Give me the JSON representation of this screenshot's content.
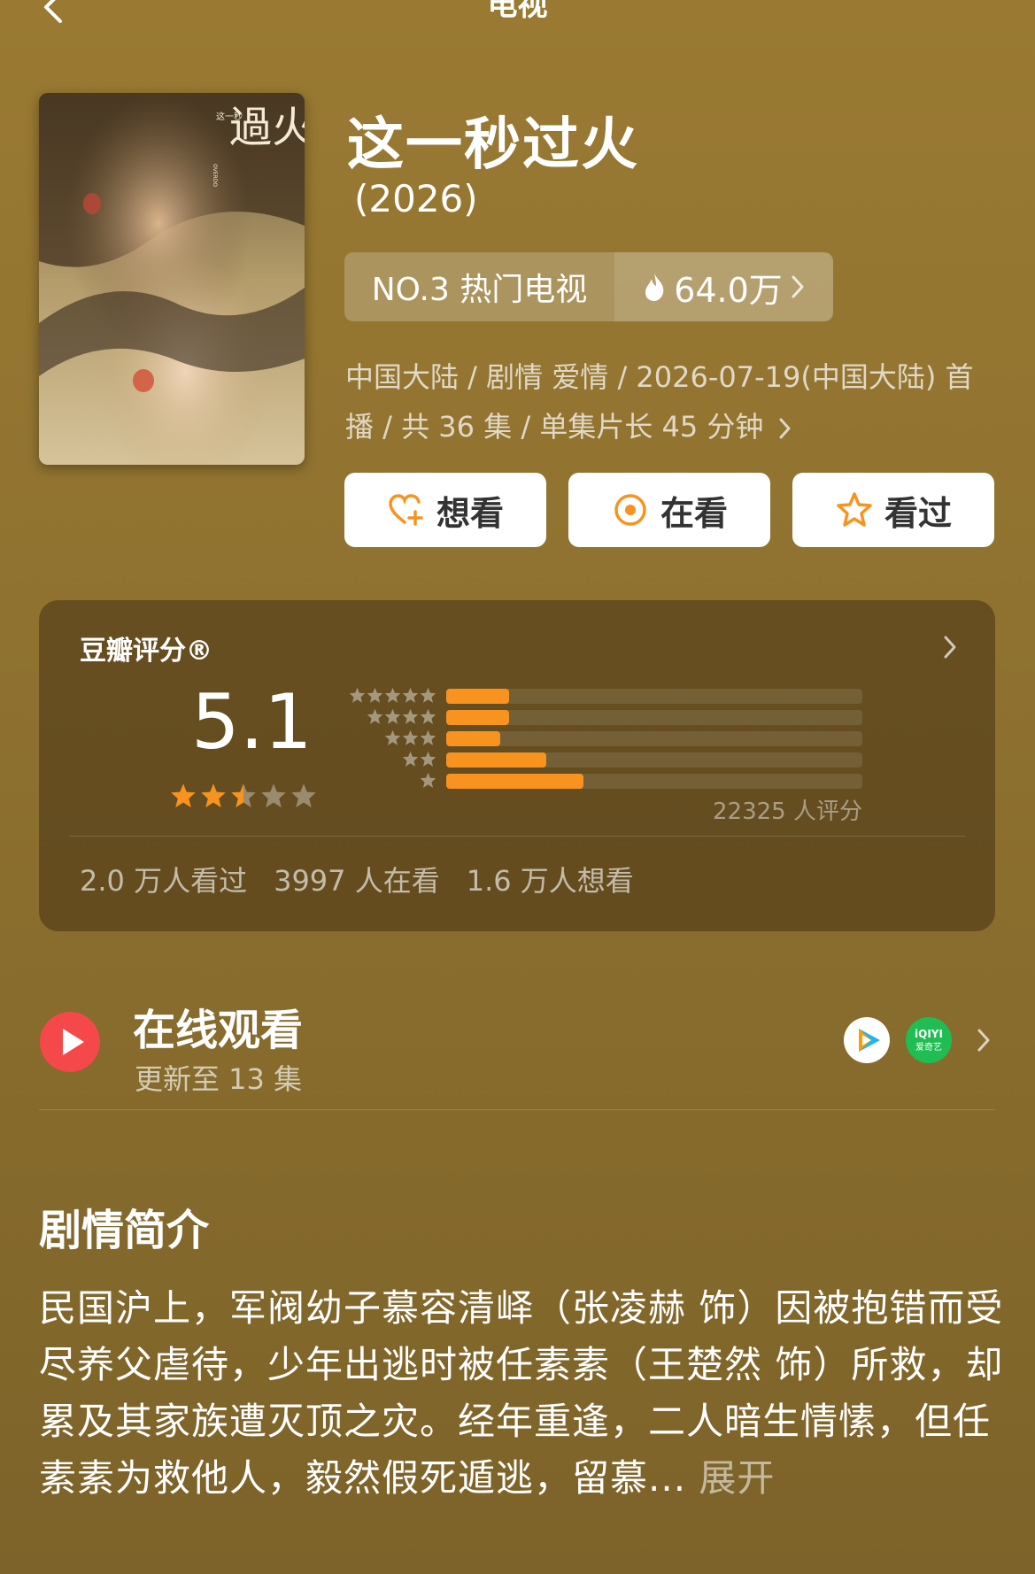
{
  "header": {
    "title": "电视"
  },
  "show": {
    "title": "这一秒过火",
    "year": "(2026)",
    "rank": "NO.3 热门电视",
    "heat": "64.0万",
    "meta": "中国大陆 / 剧情 爱情 / 2026-07-19(中国大陆) 首播 / 共 36 集 / 单集片长 45 分钟"
  },
  "poster": {
    "title_chars": "過火",
    "subtitle": "这一秒",
    "english": "OVERDO"
  },
  "actions": [
    {
      "label": "想看",
      "icon": "heart-plus-icon"
    },
    {
      "label": "在看",
      "icon": "target-icon"
    },
    {
      "label": "看过",
      "icon": "star-outline-icon"
    }
  ],
  "rating": {
    "title": "豆瓣评分®",
    "score": "5.1",
    "stars_value": 2.5,
    "distribution": [
      {
        "stars": 5,
        "fraction": 0.15
      },
      {
        "stars": 4,
        "fraction": 0.15
      },
      {
        "stars": 3,
        "fraction": 0.13
      },
      {
        "stars": 2,
        "fraction": 0.24
      },
      {
        "stars": 1,
        "fraction": 0.33
      }
    ],
    "count": "22325 人评分",
    "stats": [
      "2.0 万人看过",
      "3997 人在看",
      "1.6 万人想看"
    ]
  },
  "online": {
    "title": "在线观看",
    "subtitle": "更新至 13 集",
    "platforms": [
      "tencent-video-icon",
      "iqiyi-icon"
    ],
    "iqiyi_label": "iQIYI",
    "iqiyi_sub": "爱奇艺"
  },
  "synopsis": {
    "title": "剧情简介",
    "text": "民国沪上，军阀幼子慕容清峄（张凌赫 饰）因被抱错而受尽养父虐待，少年出逃时被任素素（王楚然 饰）所救，却累及其家族遭灭顶之灾。经年重逢，二人暗生情愫，但任素素为救他人，毅然假死遁逃，留慕...",
    "expand": " 展开"
  },
  "colors": {
    "accent": "#f7931e",
    "background": "#8f7230",
    "play": "#f5484a"
  }
}
